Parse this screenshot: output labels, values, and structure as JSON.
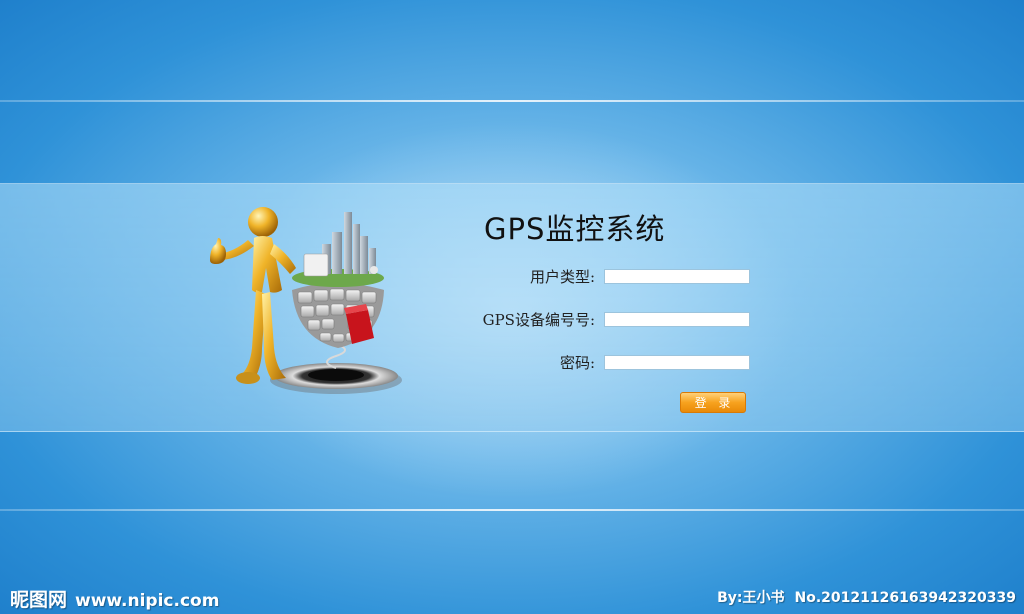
{
  "login": {
    "title": "GPS监控系统",
    "fields": [
      {
        "label": "用户类型:",
        "value": ""
      },
      {
        "label": "GPS设备编号号:",
        "value": ""
      },
      {
        "label": "密码:",
        "value": ""
      }
    ],
    "submit_label": "登 录"
  },
  "watermark": {
    "site_name": "昵图网",
    "site_url": "www.nipic.com",
    "author": "By:王小书",
    "number": "No.20121126163942320339"
  },
  "colors": {
    "background": "#3a9ade",
    "button": "#f7a21e",
    "title": "#111111"
  }
}
